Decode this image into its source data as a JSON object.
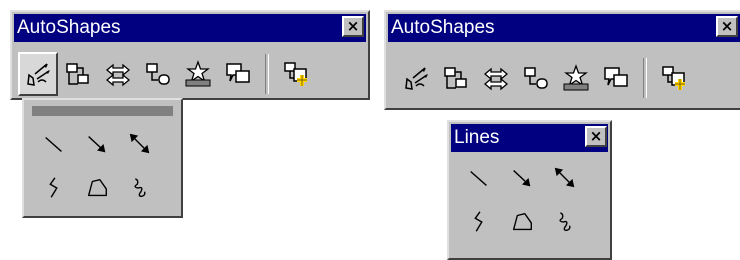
{
  "autoshapes_left": {
    "title": "AutoShapes",
    "close_label": "×"
  },
  "autoshapes_right": {
    "title": "AutoShapes",
    "close_label": "×"
  },
  "lines_palette": {
    "title": "Lines",
    "close_label": "×"
  },
  "toolbar_buttons": [
    "lines-icon",
    "connectors-icon",
    "block-arrows-icon",
    "flowchart-icon",
    "stars-banners-icon",
    "callouts-icon",
    "more-autoshapes-icon"
  ],
  "line_tools": [
    "line-icon",
    "arrow-icon",
    "double-arrow-icon",
    "curve-icon",
    "freeform-icon",
    "scribble-icon"
  ]
}
